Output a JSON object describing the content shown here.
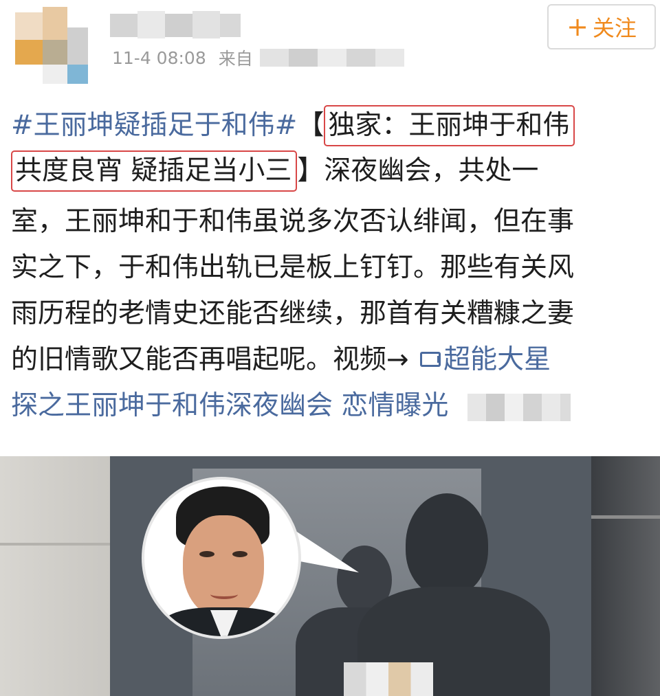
{
  "header": {
    "timestamp": "11-4 08:08",
    "source_prefix": "来自",
    "follow_label": "关注",
    "follow_icon": "plus-icon"
  },
  "post": {
    "line1": {
      "topic": "#王丽坤疑插足于和伟#",
      "bracket_open": "【",
      "highlight": "独家：王丽坤于和伟"
    },
    "line2": {
      "highlight": "共度良宵 疑插足当小三",
      "bracket_close": "】",
      "rest": "深夜幽会，共处一"
    },
    "line3": "室，王丽坤和于和伟虽说多次否认绯闻，但在事",
    "line4": "实之下，于和伟出轨已是板上钉钉。那些有关风",
    "line5": "雨历程的老情史还能否继续，那首有关糟糠之妻",
    "line6": {
      "text": "的旧情歌又能否再唱起呢。视频→ ",
      "link_icon": "video-link-icon",
      "link_text": "超能大星"
    },
    "line7": {
      "link_text": "探之王丽坤于和伟深夜幽会 恋情曝光"
    }
  },
  "colors": {
    "topic_link": "#4a6a9e",
    "highlight_border": "#d84646",
    "follow": "#f08a1d"
  }
}
